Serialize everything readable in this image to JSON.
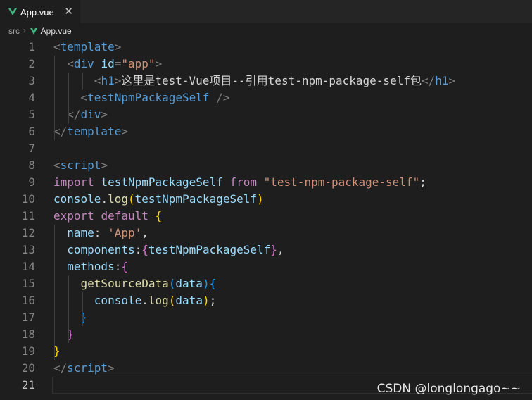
{
  "tab": {
    "label": "App.vue",
    "close_glyph": "✕"
  },
  "breadcrumb": {
    "folder": "src",
    "separator": "›",
    "file": "App.vue"
  },
  "editor": {
    "active_line": 21,
    "lines": [
      {
        "n": "1",
        "tokens": [
          {
            "t": "<",
            "c": "punct"
          },
          {
            "t": "template",
            "c": "tag"
          },
          {
            "t": ">",
            "c": "punct"
          }
        ]
      },
      {
        "n": "2",
        "tokens": [
          {
            "t": "  ",
            "c": "txt"
          },
          {
            "t": "<",
            "c": "punct"
          },
          {
            "t": "div",
            "c": "tag"
          },
          {
            "t": " ",
            "c": "txt"
          },
          {
            "t": "id",
            "c": "attr"
          },
          {
            "t": "=",
            "c": "txt"
          },
          {
            "t": "\"app\"",
            "c": "str"
          },
          {
            "t": ">",
            "c": "punct"
          }
        ]
      },
      {
        "n": "3",
        "tokens": [
          {
            "t": "      ",
            "c": "txt"
          },
          {
            "t": "<",
            "c": "punct"
          },
          {
            "t": "h1",
            "c": "tag"
          },
          {
            "t": ">",
            "c": "punct"
          },
          {
            "t": "这里是test-Vue项目--引用test-npm-package-self包",
            "c": "txt"
          },
          {
            "t": "</",
            "c": "punct"
          },
          {
            "t": "h1",
            "c": "tag"
          },
          {
            "t": ">",
            "c": "punct"
          }
        ]
      },
      {
        "n": "4",
        "tokens": [
          {
            "t": "    ",
            "c": "txt"
          },
          {
            "t": "<",
            "c": "punct"
          },
          {
            "t": "testNpmPackageSelf",
            "c": "tag"
          },
          {
            "t": " />",
            "c": "punct"
          }
        ]
      },
      {
        "n": "5",
        "tokens": [
          {
            "t": "  ",
            "c": "txt"
          },
          {
            "t": "</",
            "c": "punct"
          },
          {
            "t": "div",
            "c": "tag"
          },
          {
            "t": ">",
            "c": "punct"
          }
        ]
      },
      {
        "n": "6",
        "tokens": [
          {
            "t": "</",
            "c": "punct"
          },
          {
            "t": "template",
            "c": "tag"
          },
          {
            "t": ">",
            "c": "punct"
          }
        ]
      },
      {
        "n": "7",
        "tokens": []
      },
      {
        "n": "8",
        "tokens": [
          {
            "t": "<",
            "c": "punct"
          },
          {
            "t": "script",
            "c": "tag"
          },
          {
            "t": ">",
            "c": "punct"
          }
        ]
      },
      {
        "n": "9",
        "tokens": [
          {
            "t": "import",
            "c": "ctrl"
          },
          {
            "t": " ",
            "c": "txt"
          },
          {
            "t": "testNpmPackageSelf",
            "c": "var"
          },
          {
            "t": " ",
            "c": "txt"
          },
          {
            "t": "from",
            "c": "ctrl"
          },
          {
            "t": " ",
            "c": "txt"
          },
          {
            "t": "\"test-npm-package-self\"",
            "c": "str"
          },
          {
            "t": ";",
            "c": "txt"
          }
        ]
      },
      {
        "n": "10",
        "tokens": [
          {
            "t": "console",
            "c": "var"
          },
          {
            "t": ".",
            "c": "txt"
          },
          {
            "t": "log",
            "c": "fn"
          },
          {
            "t": "(",
            "c": "b1"
          },
          {
            "t": "testNpmPackageSelf",
            "c": "var"
          },
          {
            "t": ")",
            "c": "b1"
          }
        ]
      },
      {
        "n": "11",
        "tokens": [
          {
            "t": "export",
            "c": "ctrl"
          },
          {
            "t": " ",
            "c": "txt"
          },
          {
            "t": "default",
            "c": "ctrl"
          },
          {
            "t": " ",
            "c": "txt"
          },
          {
            "t": "{",
            "c": "b1"
          }
        ]
      },
      {
        "n": "12",
        "tokens": [
          {
            "t": "  ",
            "c": "txt"
          },
          {
            "t": "name",
            "c": "var"
          },
          {
            "t": ": ",
            "c": "txt"
          },
          {
            "t": "'App'",
            "c": "str"
          },
          {
            "t": ",",
            "c": "txt"
          }
        ]
      },
      {
        "n": "13",
        "tokens": [
          {
            "t": "  ",
            "c": "txt"
          },
          {
            "t": "components",
            "c": "var"
          },
          {
            "t": ":",
            "c": "txt"
          },
          {
            "t": "{",
            "c": "b2"
          },
          {
            "t": "testNpmPackageSelf",
            "c": "var"
          },
          {
            "t": "}",
            "c": "b2"
          },
          {
            "t": ",",
            "c": "txt"
          }
        ]
      },
      {
        "n": "14",
        "tokens": [
          {
            "t": "  ",
            "c": "txt"
          },
          {
            "t": "methods",
            "c": "var"
          },
          {
            "t": ":",
            "c": "txt"
          },
          {
            "t": "{",
            "c": "b2"
          }
        ]
      },
      {
        "n": "15",
        "tokens": [
          {
            "t": "    ",
            "c": "txt"
          },
          {
            "t": "getSourceData",
            "c": "fn"
          },
          {
            "t": "(",
            "c": "b3"
          },
          {
            "t": "data",
            "c": "var"
          },
          {
            "t": ")",
            "c": "b3"
          },
          {
            "t": "{",
            "c": "b3"
          }
        ]
      },
      {
        "n": "16",
        "tokens": [
          {
            "t": "      ",
            "c": "txt"
          },
          {
            "t": "console",
            "c": "var"
          },
          {
            "t": ".",
            "c": "txt"
          },
          {
            "t": "log",
            "c": "fn"
          },
          {
            "t": "(",
            "c": "b1"
          },
          {
            "t": "data",
            "c": "var"
          },
          {
            "t": ")",
            "c": "b1"
          },
          {
            "t": ";",
            "c": "txt"
          }
        ]
      },
      {
        "n": "17",
        "tokens": [
          {
            "t": "    ",
            "c": "txt"
          },
          {
            "t": "}",
            "c": "b3"
          }
        ]
      },
      {
        "n": "18",
        "tokens": [
          {
            "t": "  ",
            "c": "txt"
          },
          {
            "t": "}",
            "c": "b2"
          }
        ]
      },
      {
        "n": "19",
        "tokens": [
          {
            "t": "}",
            "c": "b1"
          }
        ]
      },
      {
        "n": "20",
        "tokens": [
          {
            "t": "</",
            "c": "punct"
          },
          {
            "t": "script",
            "c": "tag"
          },
          {
            "t": ">",
            "c": "punct"
          }
        ]
      },
      {
        "n": "21",
        "tokens": []
      }
    ]
  },
  "watermark": "CSDN @longlongago~~"
}
